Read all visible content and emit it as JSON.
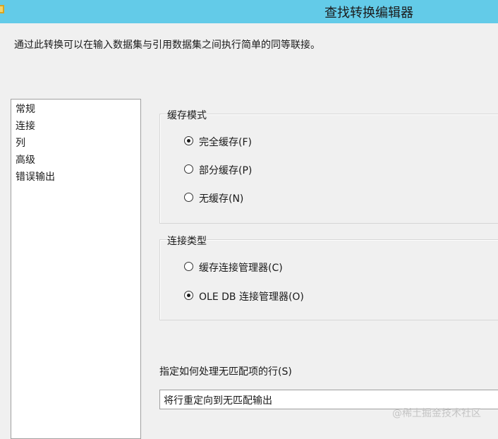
{
  "window": {
    "title": "查找转换编辑器",
    "icon": "app-icon"
  },
  "description": "通过此转换可以在输入数据集与引用数据集之间执行简单的同等联接。",
  "nav": {
    "items": [
      "常规",
      "连接",
      "列",
      "高级",
      "错误输出"
    ],
    "selected": "常规"
  },
  "cache_mode": {
    "title": "缓存模式",
    "options": [
      {
        "label": "完全缓存(F)",
        "checked": true
      },
      {
        "label": "部分缓存(P)",
        "checked": false
      },
      {
        "label": "无缓存(N)",
        "checked": false
      }
    ]
  },
  "connection_type": {
    "title": "连接类型",
    "options": [
      {
        "label": "缓存连接管理器(C)",
        "checked": false
      },
      {
        "label": "OLE DB 连接管理器(O)",
        "checked": true
      }
    ]
  },
  "unmatched": {
    "label": "指定如何处理无匹配项的行(S)",
    "value": "将行重定向到无匹配输出"
  },
  "watermark": "@稀土掘金技术社区",
  "colors": {
    "titlebar": "#63cbe8",
    "background": "#f0f0f0"
  }
}
